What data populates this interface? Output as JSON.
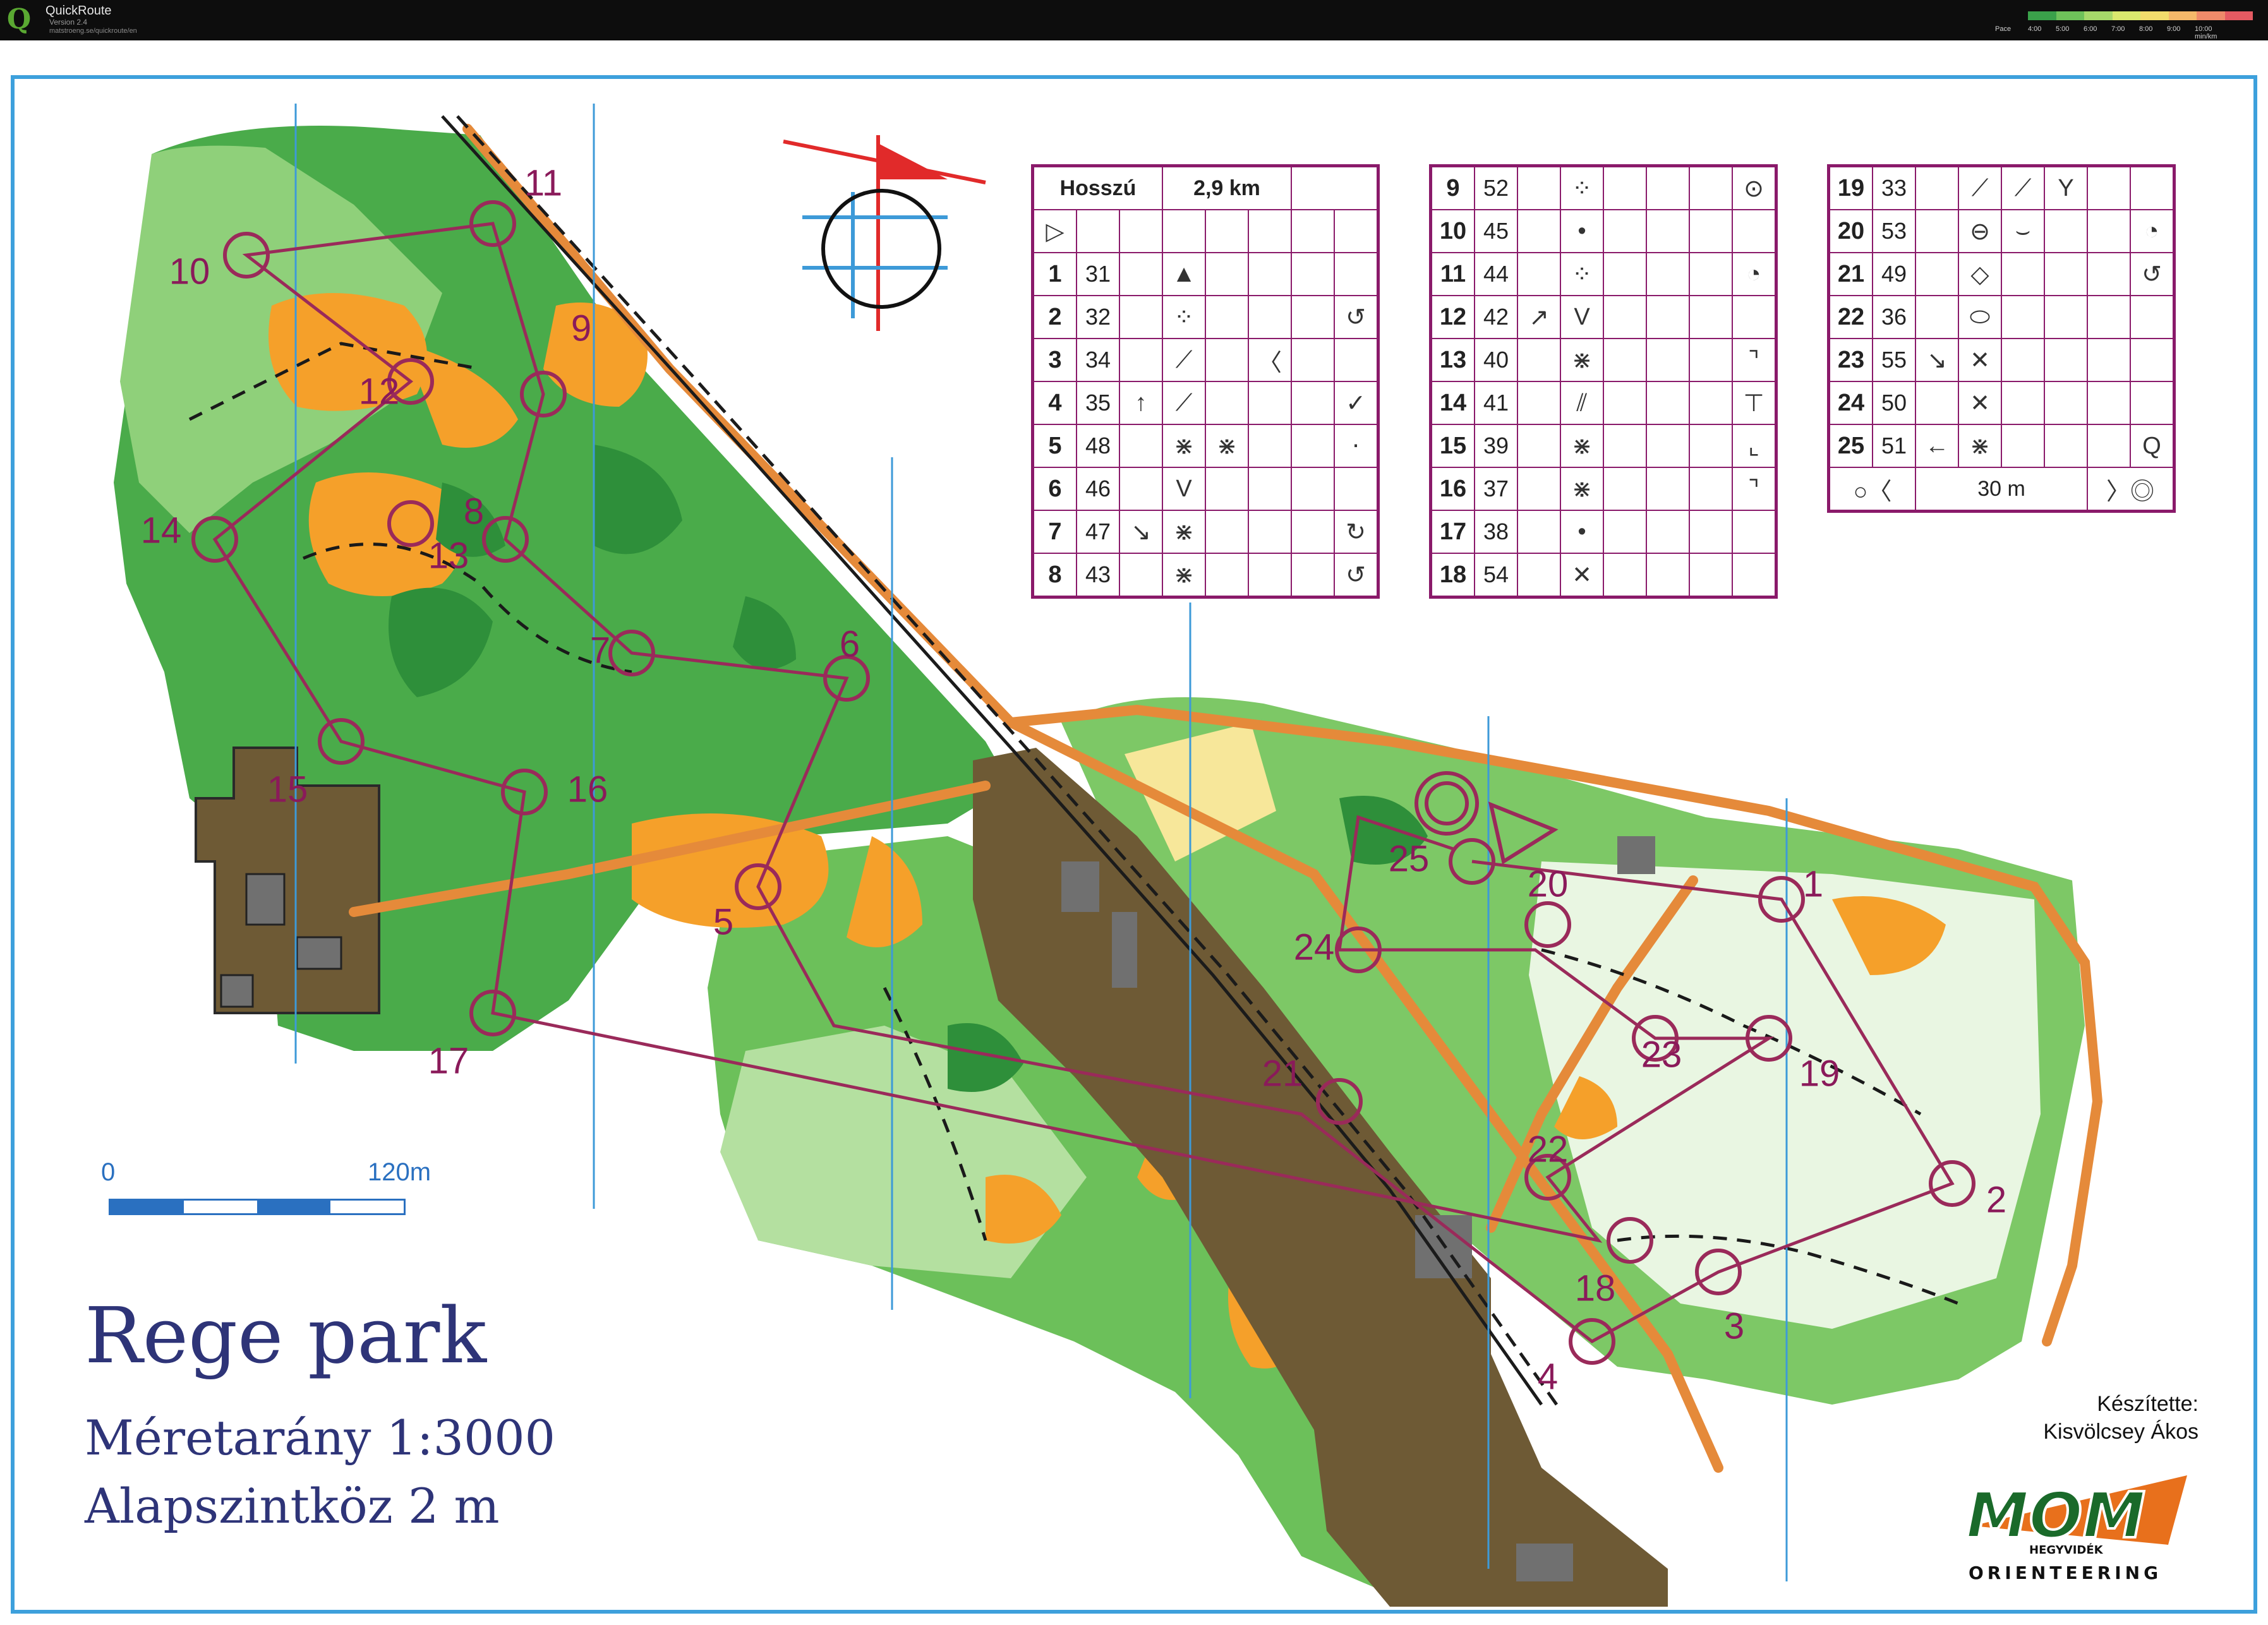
{
  "window": {
    "title": "QuickRoute",
    "version": "Version 2.4",
    "url": "matstroeng.se/quickroute/en"
  },
  "pace_legend": {
    "label": "Pace",
    "ticks": [
      "4:00",
      "5:00",
      "6:00",
      "7:00",
      "8:00",
      "9:00",
      "10:00 min/km"
    ],
    "colors": [
      "#3aa14a",
      "#6ec25a",
      "#a6d86a",
      "#d9e86e",
      "#f2dc6c",
      "#f4b86a",
      "#ee8a6a",
      "#e45a62"
    ]
  },
  "map": {
    "name": "Rege park",
    "scale_text": "Méretarány 1:3000",
    "contour_text": "Alapszintköz 2 m",
    "scalebar": {
      "start": "0",
      "end": "120m"
    },
    "credits_label": "Készítette:",
    "credits_author": "Kisvölcsey Ákos",
    "logo": {
      "main": "MOM",
      "sub": "HEGYVIDÉK",
      "bottom": "ORIENTEERING"
    },
    "colors": {
      "green_dark": "#3aa24a",
      "green_mid": "#6cc05a",
      "green_light": "#b4e0a0",
      "yellow": "#f5a02a",
      "brown": "#6e5a35",
      "course": "#9a2a5a",
      "north_line": "#3d9ad8"
    }
  },
  "controls": [
    {
      "number": "1"
    },
    {
      "number": "2"
    },
    {
      "number": "3"
    },
    {
      "number": "4"
    },
    {
      "number": "5"
    },
    {
      "number": "6"
    },
    {
      "number": "7"
    },
    {
      "number": "8"
    },
    {
      "number": "9"
    },
    {
      "number": "10"
    },
    {
      "number": "11"
    },
    {
      "number": "12"
    },
    {
      "number": "13"
    },
    {
      "number": "14"
    },
    {
      "number": "15"
    },
    {
      "number": "16"
    },
    {
      "number": "17"
    },
    {
      "number": "18"
    },
    {
      "number": "19"
    },
    {
      "number": "20"
    },
    {
      "number": "21"
    },
    {
      "number": "22"
    },
    {
      "number": "23"
    },
    {
      "number": "24"
    },
    {
      "number": "25"
    }
  ],
  "descriptions": {
    "course_name": "Hosszú",
    "length": "2,9 km",
    "start_symbol": "▷",
    "finish_distance": "30 m",
    "finish_left": "○〈",
    "finish_right": "〉◎",
    "rows": [
      {
        "seq": "1",
        "code": "31",
        "d": "",
        "e": "▲",
        "f": "",
        "g": "",
        "h": ""
      },
      {
        "seq": "2",
        "code": "32",
        "d": "",
        "e": "⁘",
        "f": "",
        "g": "",
        "h": "↺"
      },
      {
        "seq": "3",
        "code": "34",
        "d": "",
        "e": "⟋",
        "f": "",
        "g": "〈",
        "h": ""
      },
      {
        "seq": "4",
        "code": "35",
        "d": "↑",
        "e": "⟋",
        "f": "",
        "g": "",
        "h": "✓"
      },
      {
        "seq": "5",
        "code": "48",
        "d": "",
        "e": "⋇",
        "f": "⋇",
        "g": "",
        "h": "⋅"
      },
      {
        "seq": "6",
        "code": "46",
        "d": "",
        "e": "V",
        "f": "",
        "g": "",
        "h": ""
      },
      {
        "seq": "7",
        "code": "47",
        "d": "↘",
        "e": "⋇",
        "f": "",
        "g": "",
        "h": "↻"
      },
      {
        "seq": "8",
        "code": "43",
        "d": "",
        "e": "⋇",
        "f": "",
        "g": "",
        "h": "↺"
      },
      {
        "seq": "9",
        "code": "52",
        "d": "",
        "e": "⁘",
        "f": "",
        "g": "",
        "h": "⊙"
      },
      {
        "seq": "10",
        "code": "45",
        "d": "",
        "e": "•",
        "f": "",
        "g": "",
        "h": ""
      },
      {
        "seq": "11",
        "code": "44",
        "d": "",
        "e": "⁘",
        "f": "",
        "g": "",
        "h": "◔"
      },
      {
        "seq": "12",
        "code": "42",
        "d": "↗",
        "e": "V",
        "f": "",
        "g": "",
        "h": ""
      },
      {
        "seq": "13",
        "code": "40",
        "d": "",
        "e": "⋇",
        "f": "",
        "g": "",
        "h": "⌝"
      },
      {
        "seq": "14",
        "code": "41",
        "d": "",
        "e": "⫽",
        "f": "",
        "g": "",
        "h": "⊤"
      },
      {
        "seq": "15",
        "code": "39",
        "d": "",
        "e": "⋇",
        "f": "",
        "g": "",
        "h": "⌞"
      },
      {
        "seq": "16",
        "code": "37",
        "d": "",
        "e": "⋇",
        "f": "",
        "g": "",
        "h": "⌝"
      },
      {
        "seq": "17",
        "code": "38",
        "d": "",
        "e": "•",
        "f": "",
        "g": "",
        "h": ""
      },
      {
        "seq": "18",
        "code": "54",
        "d": "",
        "e": "✕",
        "f": "",
        "g": "",
        "h": ""
      },
      {
        "seq": "19",
        "code": "33",
        "d": "",
        "e": "⟋",
        "f": "⟋",
        "g": "Y",
        "h": ""
      },
      {
        "seq": "20",
        "code": "53",
        "d": "",
        "e": "⊖",
        "f": "⌣",
        "g": "",
        "h": "◔"
      },
      {
        "seq": "21",
        "code": "49",
        "d": "",
        "e": "◇",
        "f": "",
        "g": "",
        "h": "↺"
      },
      {
        "seq": "22",
        "code": "36",
        "d": "",
        "e": "⬭",
        "f": "",
        "g": "",
        "h": ""
      },
      {
        "seq": "23",
        "code": "55",
        "d": "↘",
        "e": "✕",
        "f": "",
        "g": "",
        "h": ""
      },
      {
        "seq": "24",
        "code": "50",
        "d": "",
        "e": "✕",
        "f": "",
        "g": "",
        "h": ""
      },
      {
        "seq": "25",
        "code": "51",
        "d": "←",
        "e": "⋇",
        "f": "",
        "g": "",
        "h": "Q"
      }
    ]
  }
}
